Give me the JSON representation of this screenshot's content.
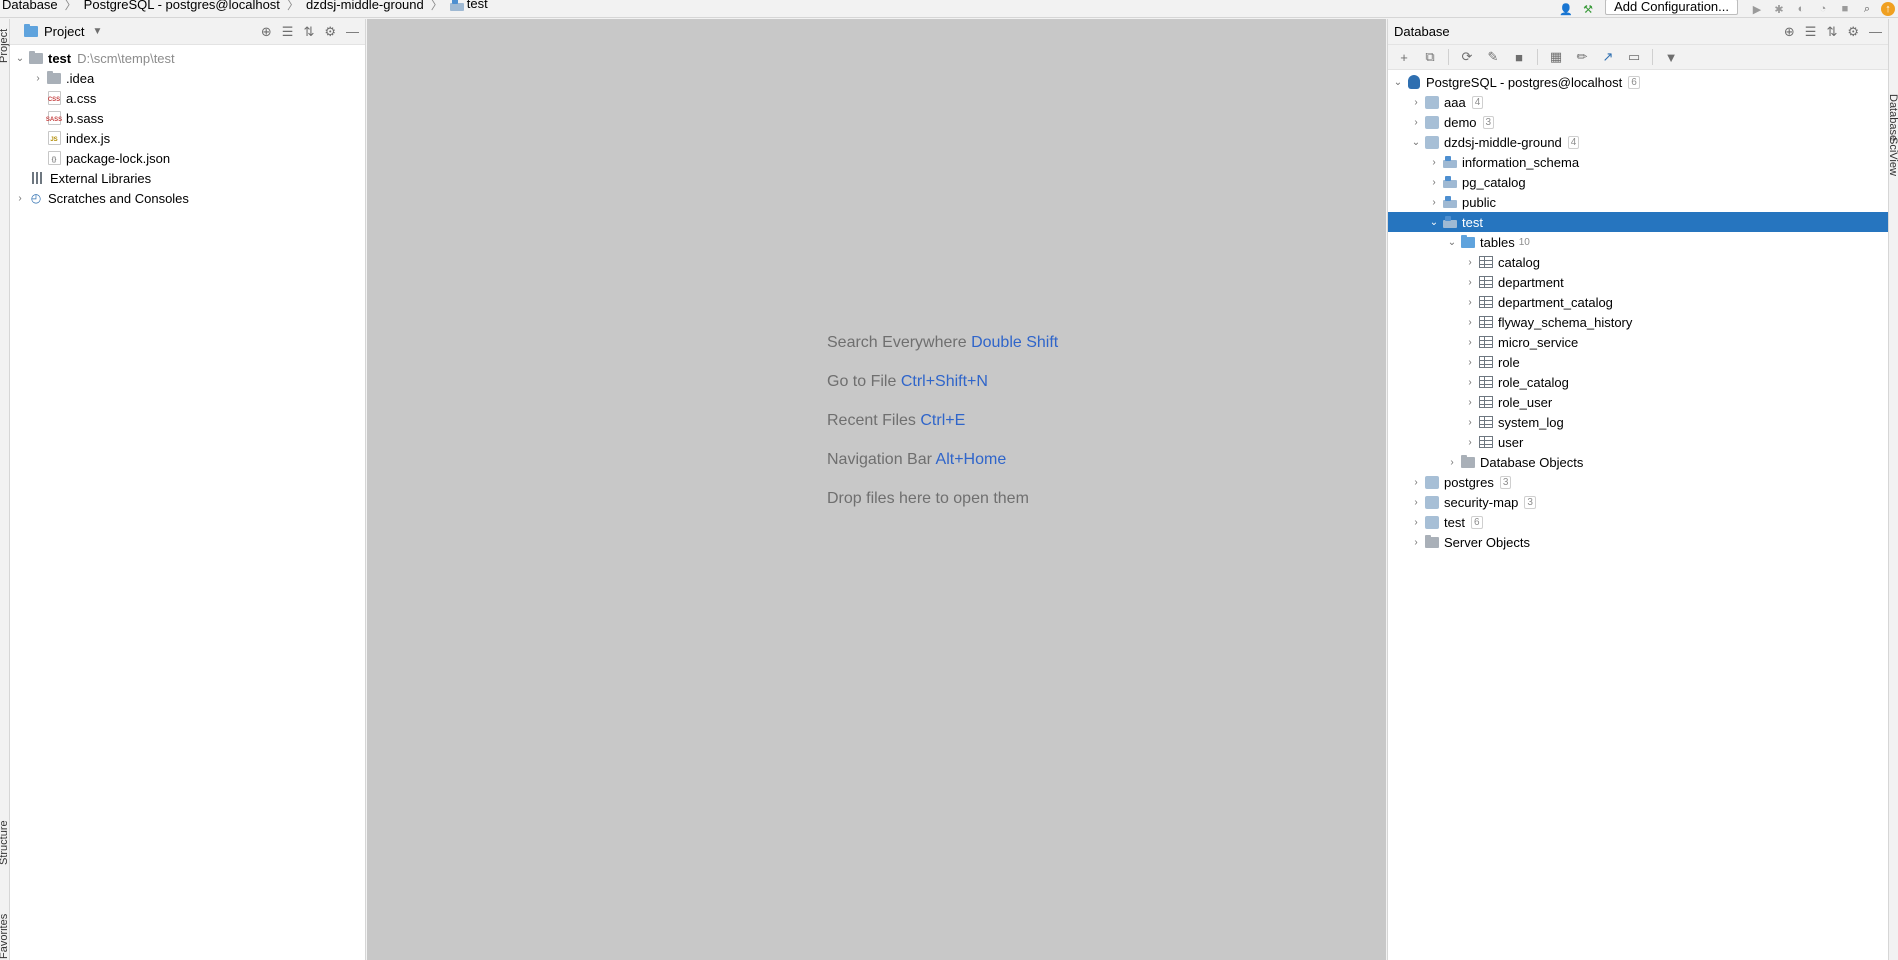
{
  "breadcrumb": {
    "items": [
      "Database",
      "PostgreSQL - postgres@localhost",
      "dzdsj-middle-ground",
      "test"
    ]
  },
  "toolbar": {
    "add_configuration": "Add Configuration..."
  },
  "left_stripe": {
    "tabs": [
      "Project",
      "Structure",
      "Favorites"
    ]
  },
  "project": {
    "title": "Project",
    "root_name": "test",
    "root_path": "D:\\scm\\temp\\test",
    "items": [
      ".idea",
      "a.css",
      "b.sass",
      "index.js",
      "package-lock.json"
    ],
    "external_libraries": "External Libraries",
    "scratches": "Scratches and Consoles"
  },
  "editor": {
    "hints": [
      {
        "label": "Search Everywhere",
        "key": "Double Shift"
      },
      {
        "label": "Go to File",
        "key": "Ctrl+Shift+N"
      },
      {
        "label": "Recent Files",
        "key": "Ctrl+E"
      },
      {
        "label": "Navigation Bar",
        "key": "Alt+Home"
      },
      {
        "label": "Drop files here to open them",
        "key": ""
      }
    ]
  },
  "database": {
    "title": "Database",
    "connection": {
      "name": "PostgreSQL - postgres@localhost",
      "count": "6"
    },
    "databases": [
      {
        "name": "aaa",
        "count": "4"
      },
      {
        "name": "demo",
        "count": "3"
      },
      {
        "name": "dzdsj-middle-ground",
        "count": "4"
      },
      {
        "name": "postgres",
        "count": "3"
      },
      {
        "name": "security-map",
        "count": "3"
      },
      {
        "name": "test",
        "count": "6"
      }
    ],
    "schemas": [
      "information_schema",
      "pg_catalog",
      "public",
      "test"
    ],
    "tables_folder": {
      "name": "tables",
      "count": "10"
    },
    "tables": [
      "catalog",
      "department",
      "department_catalog",
      "flyway_schema_history",
      "micro_service",
      "role",
      "role_catalog",
      "role_user",
      "system_log",
      "user"
    ],
    "db_objects": "Database Objects",
    "server_objects": "Server Objects"
  },
  "right_stripe": {
    "tabs": [
      "Database",
      "SciView"
    ]
  },
  "colors": {
    "selection": "#2675bf",
    "editor_bg": "#c8c8c8",
    "hint_key": "#2f65ca"
  }
}
